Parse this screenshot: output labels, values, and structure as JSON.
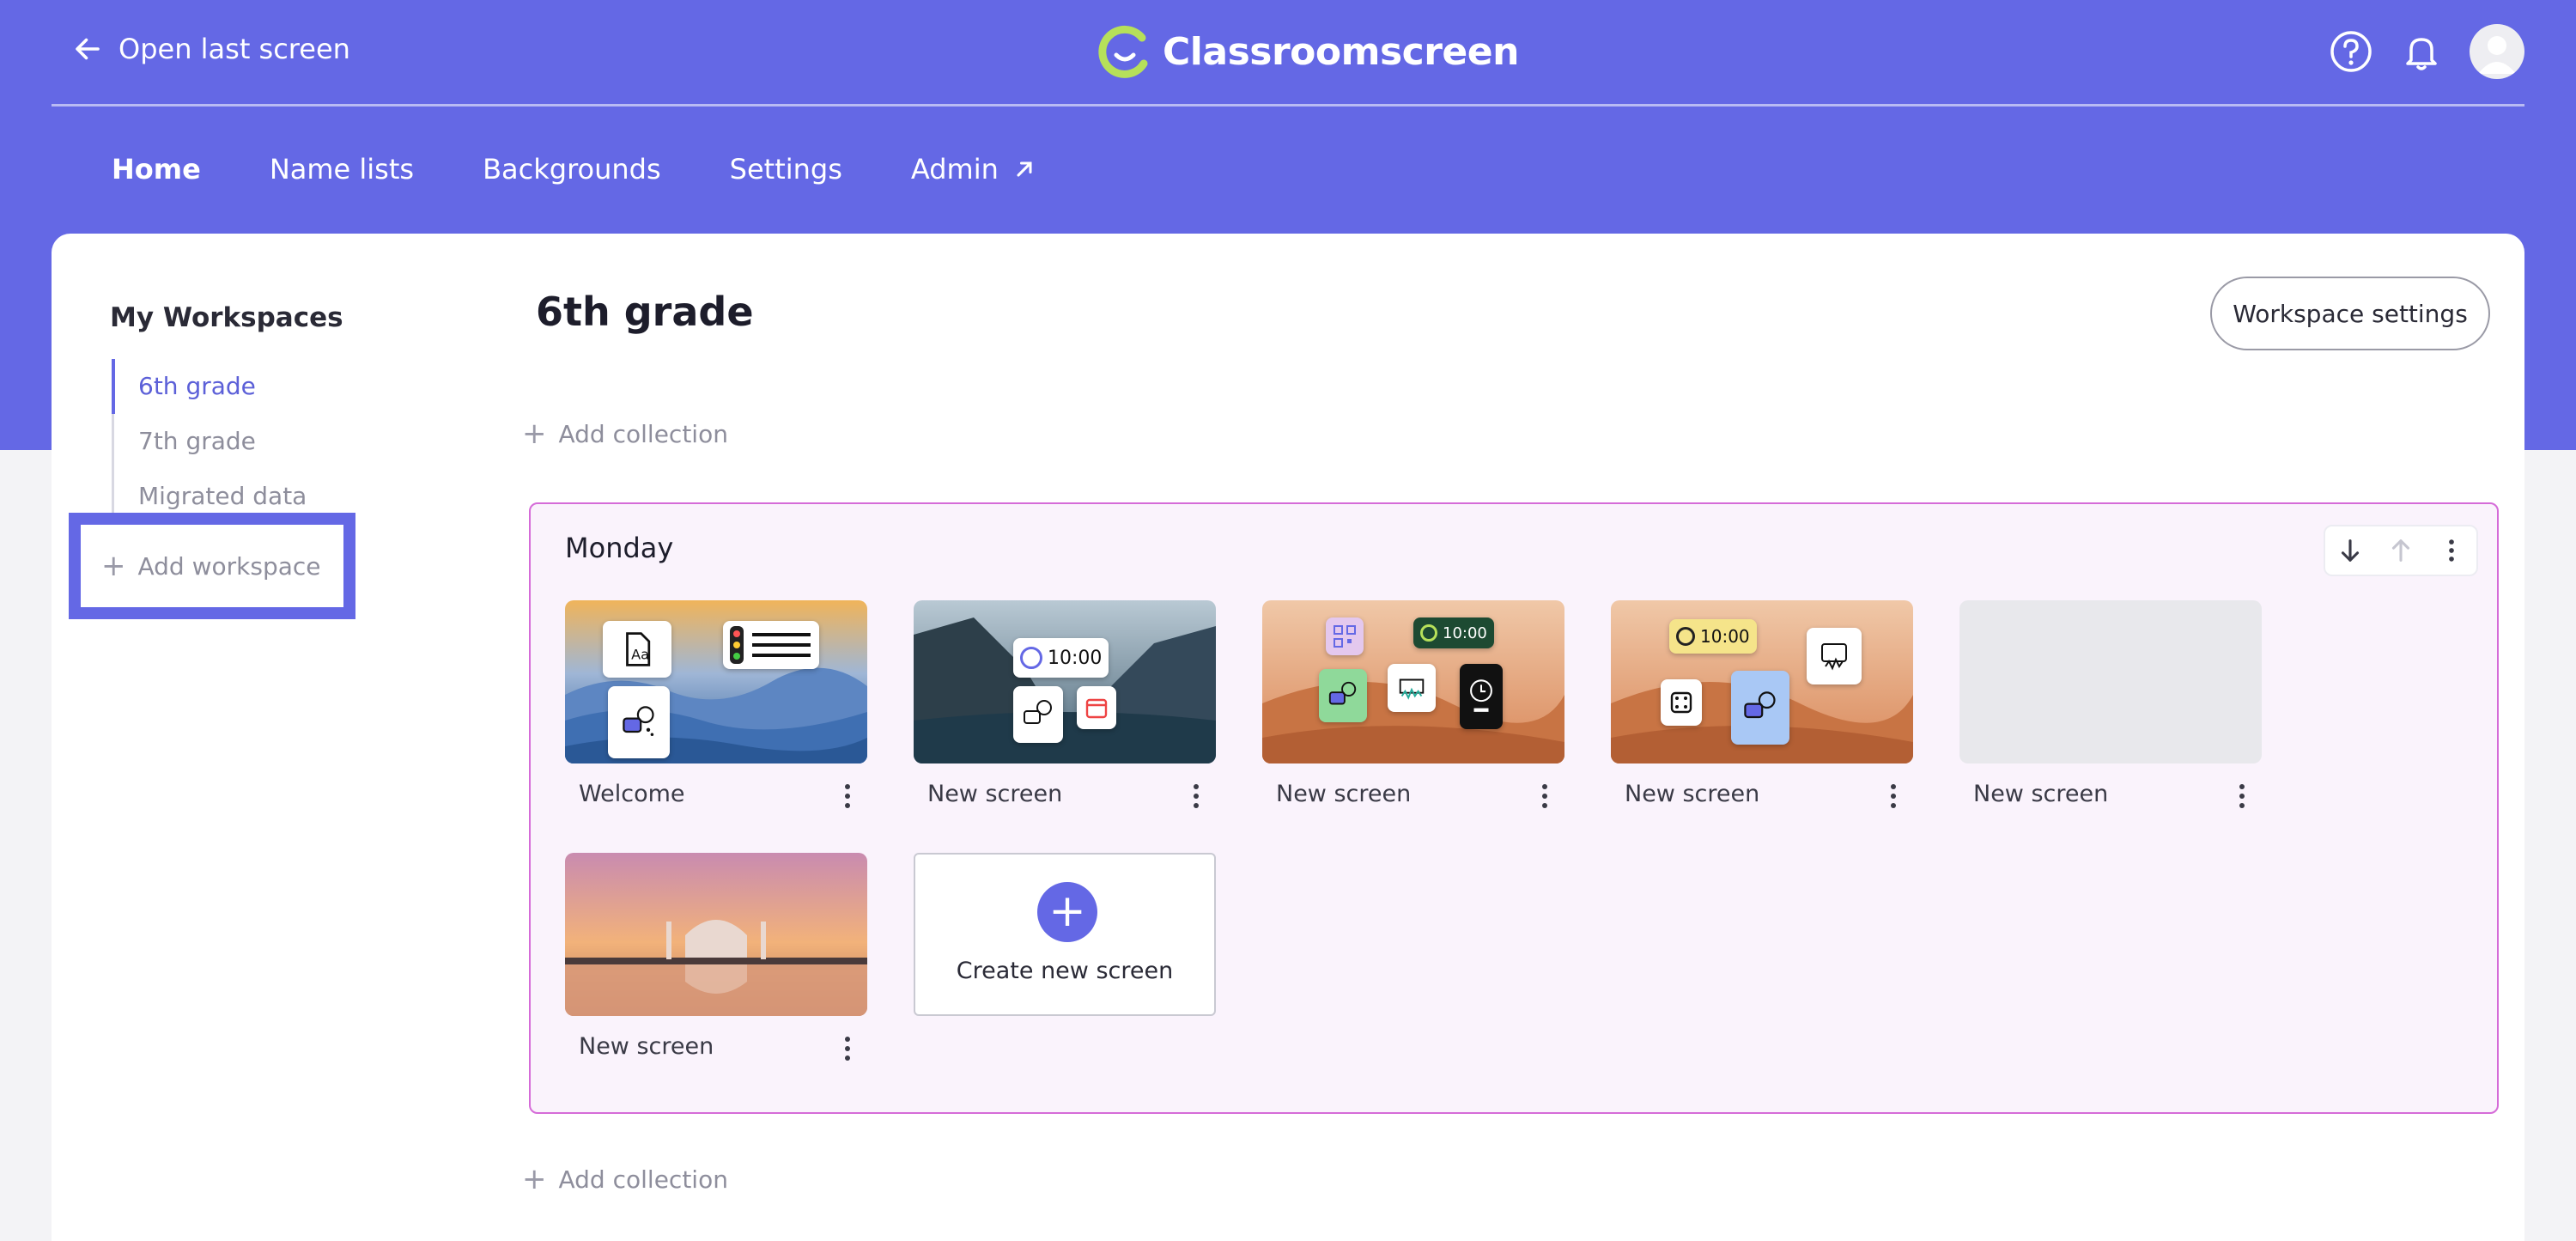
{
  "header": {
    "back_label": "Open last screen",
    "brand_name": "Classroomscreen"
  },
  "nav": {
    "items": [
      {
        "label": "Home",
        "active": true
      },
      {
        "label": "Name lists"
      },
      {
        "label": "Backgrounds"
      },
      {
        "label": "Settings"
      },
      {
        "label": "Admin",
        "external": true
      }
    ]
  },
  "sidebar": {
    "title": "My Workspaces",
    "workspaces": [
      {
        "label": "6th grade",
        "active": true
      },
      {
        "label": "7th grade"
      },
      {
        "label": "Migrated data"
      }
    ],
    "add_label": "Add workspace"
  },
  "main": {
    "title": "6th grade",
    "settings_label": "Workspace settings",
    "add_collection_label": "Add collection",
    "collection": {
      "title": "Monday",
      "screens": [
        {
          "label": "Welcome"
        },
        {
          "label": "New screen"
        },
        {
          "label": "New screen"
        },
        {
          "label": "New screen"
        },
        {
          "label": "New screen"
        },
        {
          "label": "New screen"
        }
      ],
      "create_label": "Create new screen",
      "timer_text": "10:00"
    }
  },
  "colors": {
    "brand": "#6468e5",
    "collection_border": "#d56bd8",
    "collection_bg": "#faf3fc"
  },
  "icons": [
    "arrow-left-icon",
    "brand-logo-icon",
    "help-icon",
    "bell-icon",
    "avatar",
    "external-link-icon",
    "plus-icon",
    "arrow-down-icon",
    "arrow-up-icon",
    "more-vertical-icon"
  ]
}
